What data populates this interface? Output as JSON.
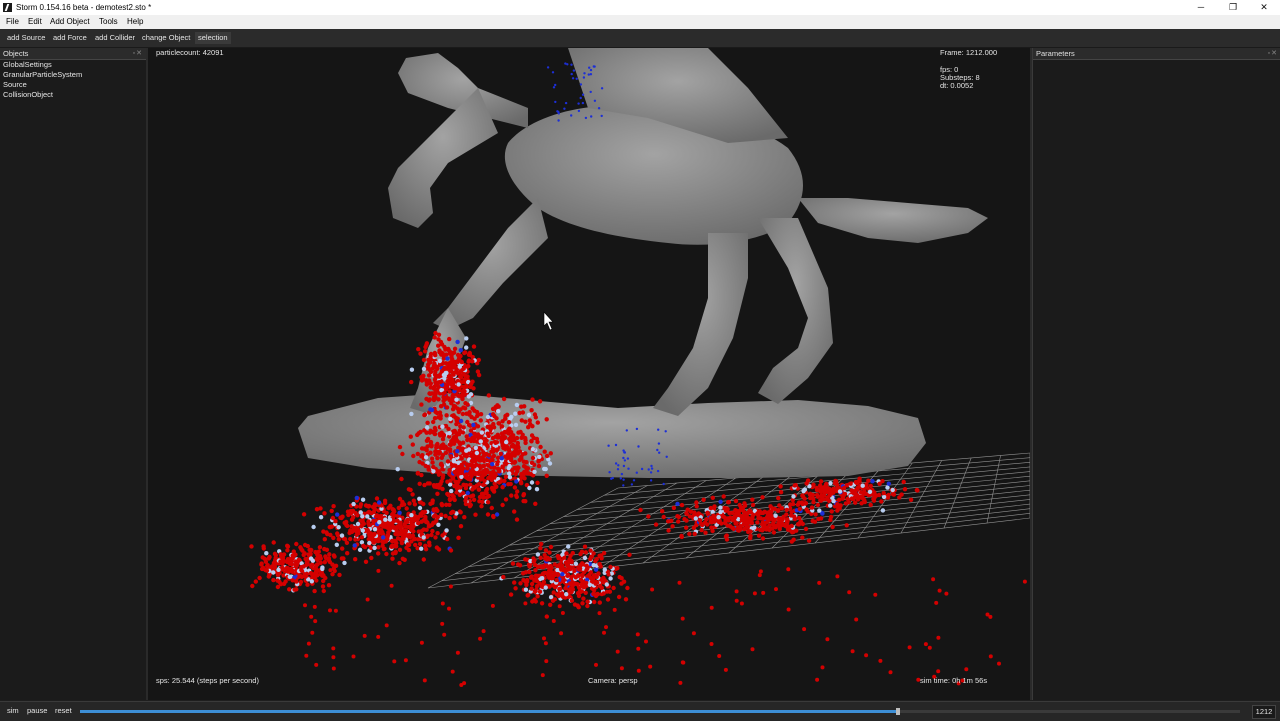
{
  "window": {
    "title": "Storm 0.154.16 beta - demotest2.sto *",
    "min": "─",
    "restore": "❐",
    "close": "✕"
  },
  "menu": [
    "File",
    "Edit",
    "Add Object",
    "Tools",
    "Help"
  ],
  "toolbar": [
    "add Source",
    "add Force",
    "add Collider",
    "change Object",
    "selection"
  ],
  "objects_panel": {
    "title": "Objects",
    "header_icons": "▫✕",
    "items": [
      "GlobalSettings",
      "GranularParticleSystem",
      "Source",
      "CollisionObject"
    ]
  },
  "parameters_panel": {
    "title": "Parameters",
    "header_icons": "▫✕"
  },
  "viewport": {
    "particlecount": "particlecount: 42091",
    "frame": "Frame: 1212.000",
    "fps": "fps: 0",
    "substeps": "Substeps: 8",
    "dt": "dt: 0.0052",
    "sps": "sps: 25.544 (steps per second)",
    "camera": "Camera: persp",
    "simtime": "sim time:  0h  1m 56s",
    "colors": {
      "particles": "#d40000",
      "particles_light": "#b8cdf0",
      "particles_blue": "#1d2fd6",
      "statue": "#8e8e8e",
      "grid": "#cfcfcf"
    }
  },
  "bottom": {
    "sim": "sim",
    "pause": "pause",
    "reset": "reset",
    "frame": "1212",
    "progress": 0.705
  }
}
